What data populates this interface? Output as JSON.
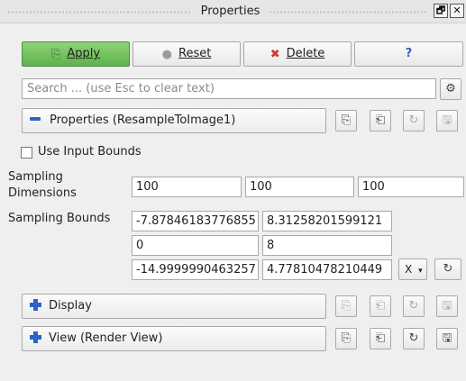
{
  "titlebar": {
    "title": "Properties",
    "float_glyph": "🗗",
    "close_glyph": "✕"
  },
  "toolbar": {
    "apply_label": "Apply",
    "reset_label": "Reset",
    "delete_label": "Delete",
    "help_label": "?",
    "apply_icon": "⎘",
    "reset_icon": "●",
    "delete_icon": "✖"
  },
  "search": {
    "placeholder": "Search ... (use Esc to clear text)",
    "settings_icon": "⚙"
  },
  "properties_section": {
    "label": "Properties (ResampleToImage1)"
  },
  "options": {
    "use_input_bounds_label": "Use Input Bounds",
    "use_input_bounds_checked": false
  },
  "sampling_dimensions": {
    "label": "Sampling Dimensions",
    "values": [
      "100",
      "100",
      "100"
    ]
  },
  "sampling_bounds": {
    "label": "Sampling Bounds",
    "rows": [
      [
        "-7.87846183776855",
        "8.31258201599121"
      ],
      [
        "0",
        "8"
      ],
      [
        "-14.9999990463257",
        "4.77810478210449"
      ]
    ],
    "axis_dropdown": "X",
    "axis_arrow": "▾",
    "reset_icon": "↻"
  },
  "display_section": {
    "label": "Display"
  },
  "view_section": {
    "label": "View (Render View)"
  },
  "section_buttons": {
    "copy_icon": "⎘",
    "paste_icon": "⎗",
    "reset_icon": "↻",
    "save_icon": "🖫"
  },
  "colors": {
    "apply_green": "#6cbf5a",
    "accent_blue": "#2f62c9",
    "delete_red": "#d13a2a",
    "help_blue": "#2e5fbf"
  }
}
